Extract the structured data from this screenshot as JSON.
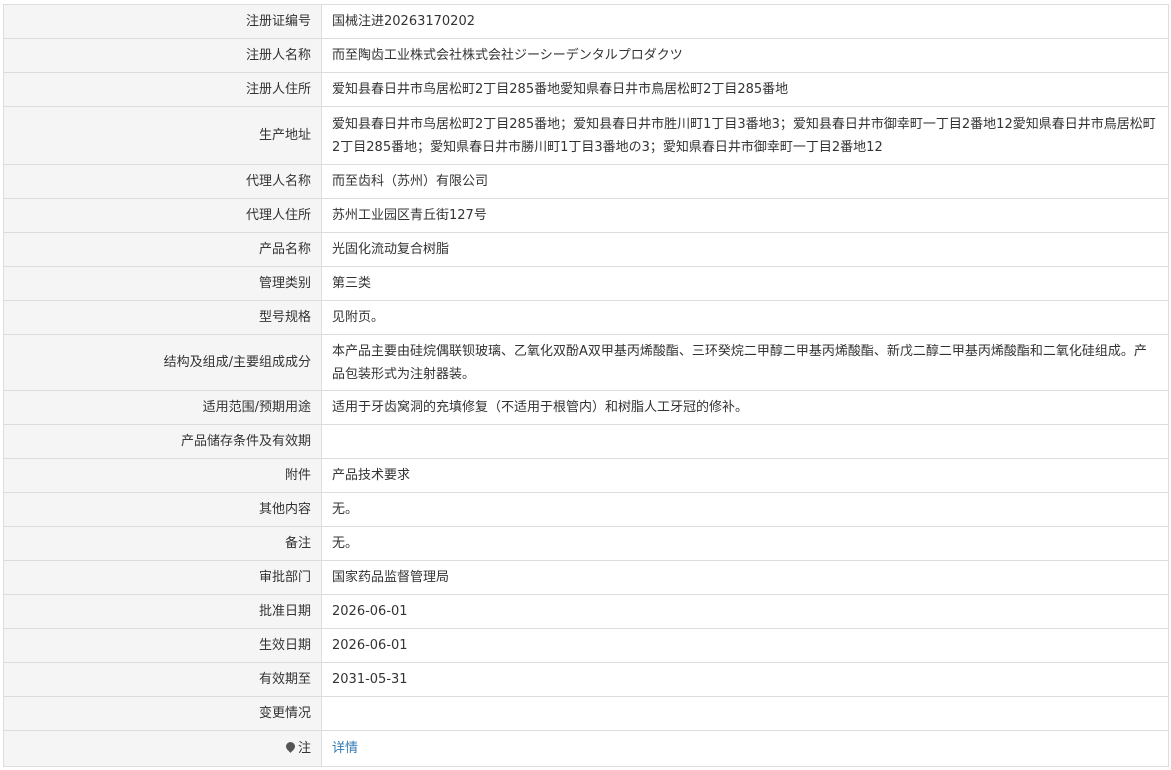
{
  "rows": [
    {
      "label": "注册证编号",
      "value": "国械注进20263170202"
    },
    {
      "label": "注册人名称",
      "value": "而至陶齿工业株式会社株式会社ジーシーデンタルプロダクツ"
    },
    {
      "label": "注册人住所",
      "value": "爱知县春日井市鸟居松町2丁目285番地愛知県春日井市鳥居松町2丁目285番地"
    },
    {
      "label": "生产地址",
      "value": "爱知县春日井市鸟居松町2丁目285番地；爱知县春日井市胜川町1丁目3番地3；爱知县春日井市御幸町一丁目2番地12愛知県春日井市鳥居松町2丁目285番地；愛知県春日井市勝川町1丁目3番地の3；愛知県春日井市御幸町一丁目2番地12"
    },
    {
      "label": "代理人名称",
      "value": "而至齿科（苏州）有限公司"
    },
    {
      "label": "代理人住所",
      "value": "苏州工业园区青丘街127号"
    },
    {
      "label": "产品名称",
      "value": "光固化流动复合树脂"
    },
    {
      "label": "管理类别",
      "value": "第三类"
    },
    {
      "label": "型号规格",
      "value": "见附页。"
    },
    {
      "label": "结构及组成/主要组成成分",
      "value": "本产品主要由硅烷偶联钡玻璃、乙氧化双酚A双甲基丙烯酸酯、三环癸烷二甲醇二甲基丙烯酸酯、新戊二醇二甲基丙烯酸酯和二氧化硅组成。产品包装形式为注射器装。"
    },
    {
      "label": "适用范围/预期用途",
      "value": "适用于牙齿窝洞的充填修复（不适用于根管内）和树脂人工牙冠的修补。"
    },
    {
      "label": "产品储存条件及有效期",
      "value": ""
    },
    {
      "label": "附件",
      "value": "产品技术要求"
    },
    {
      "label": "其他内容",
      "value": "无。"
    },
    {
      "label": "备注",
      "value": "无。"
    },
    {
      "label": "审批部门",
      "value": "国家药品监督管理局"
    },
    {
      "label": "批准日期",
      "value": "2026-06-01"
    },
    {
      "label": "生效日期",
      "value": "2026-06-01"
    },
    {
      "label": "有效期至",
      "value": "2031-05-31"
    },
    {
      "label": "变更情况",
      "value": ""
    }
  ],
  "note_row": {
    "label": "注",
    "icon": "pin-icon",
    "link_text": "详情"
  }
}
